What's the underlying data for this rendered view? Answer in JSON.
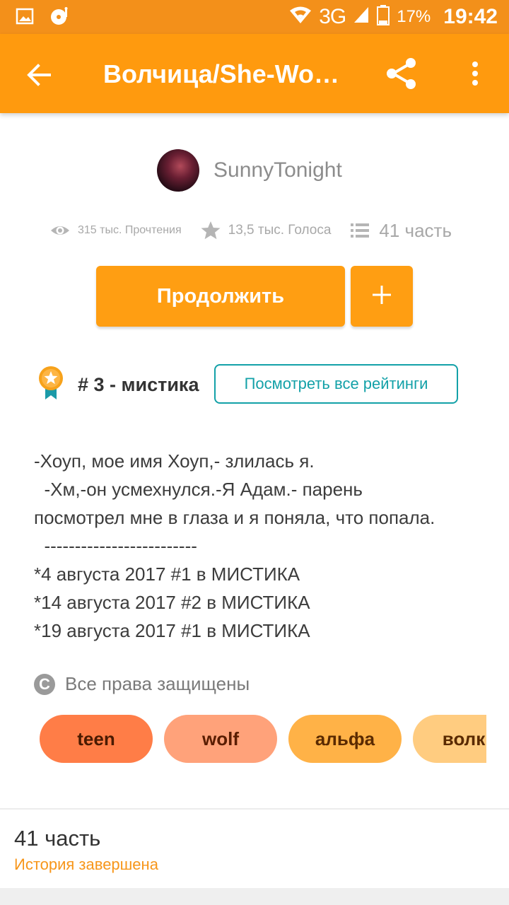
{
  "status_bar": {
    "network": "3G",
    "battery": "17%",
    "time": "19:42",
    "icons": [
      "image-icon",
      "disc-icon",
      "wifi-icon",
      "signal-icon",
      "battery-icon"
    ]
  },
  "app_bar": {
    "title": "Волчица/She-Wo…",
    "icons": [
      "back-arrow-icon",
      "share-icon",
      "more-vert-icon"
    ]
  },
  "author": {
    "name": "SunnyTonight"
  },
  "stats": {
    "reads": "315 тыс. Прочтения",
    "votes": "13,5 тыс. Голоса",
    "parts": "41 часть"
  },
  "actions": {
    "continue_label": "Продолжить",
    "add_label": "+"
  },
  "ranking": {
    "text": "# 3 - мистика",
    "button_label": "Посмотреть все рейтинги"
  },
  "description": {
    "lines": [
      "-Хоуп, мое имя Хоуп,- злилась я.",
      "  -Хм,-он усмехнулся.-Я Адам.- парень",
      "посмотрел мне в глаза и я поняла, что попала.",
      "  -------------------------",
      "*4 августа 2017 #1 в МИСТИКА",
      "*14 августа 2017 #2 в МИСТИКА",
      "*19 августа 2017 #1 в МИСТИКА"
    ]
  },
  "copyright": {
    "icon_letter": "C",
    "text": "Все права защищены"
  },
  "tags": [
    {
      "label": "teen",
      "bg": "#ff7d47",
      "color": "#4a1a00"
    },
    {
      "label": "wolf",
      "bg": "#ffa27a",
      "color": "#5a1d00"
    },
    {
      "label": "альфа",
      "bg": "#ffb247",
      "color": "#5a2a00"
    },
    {
      "label": "волки",
      "bg": "#ffcc80",
      "color": "#5a2a00"
    }
  ],
  "footer": {
    "parts": "41 часть",
    "status": "История завершена"
  },
  "colors": {
    "accent": "#ff9a0e",
    "status_bar": "#f3901a",
    "teal": "#13a1a8",
    "status_text": "#f7961a"
  }
}
